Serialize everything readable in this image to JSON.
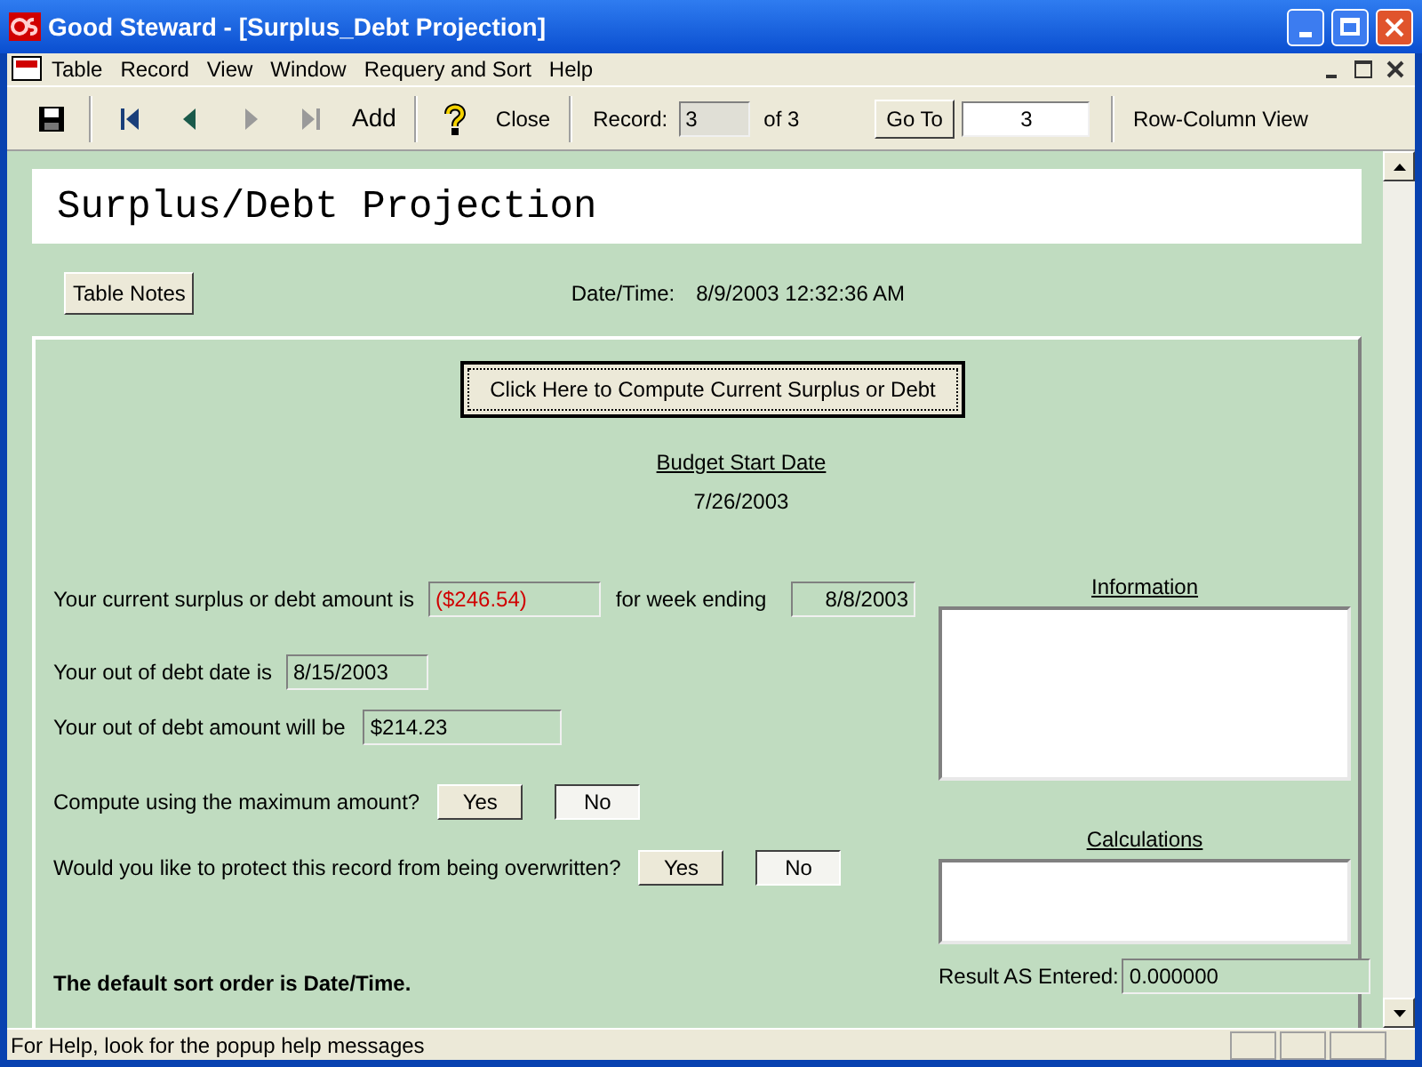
{
  "window": {
    "title": "Good Steward - [Surplus_Debt Projection]"
  },
  "menu": [
    "Table",
    "Record",
    "View",
    "Window",
    "Requery and Sort",
    "Help"
  ],
  "toolbar": [
    {
      "kind": "save",
      "disabled": false
    },
    {
      "kind": "first",
      "disabled": false
    },
    {
      "kind": "prev",
      "disabled": false
    },
    {
      "kind": "next",
      "disabled": true
    },
    {
      "kind": "last",
      "disabled": true
    },
    {
      "kind": "text",
      "label": "Add",
      "disabled": false
    },
    {
      "kind": "help",
      "disabled": false
    },
    {
      "kind": "text",
      "label": "Close",
      "disabled": false
    }
  ],
  "record": {
    "label": "Record:",
    "value": "3",
    "of": "of  3",
    "goto_button": "Go To",
    "goto_value": "3",
    "view_button": "Row-Column View"
  },
  "form": {
    "heading": "Surplus/Debt Projection",
    "table_notes_button": "Table Notes",
    "datetime_label": "Date/Time:",
    "datetime_value": "8/9/2003 12:32:36 AM",
    "compute_button": "Click Here to Compute Current Surplus or Debt",
    "budget_start_label": "Budget Start Date",
    "budget_start_value": "7/26/2003",
    "surplus_label": "Your current surplus or debt amount is",
    "surplus_value": "($246.54)",
    "surplus_negative": true,
    "week_label": "for week ending",
    "week_value": "8/8/2003",
    "debt_date_label": "Your out of debt date is",
    "debt_date_value": "8/15/2003",
    "debt_amount_label": "Your out of debt amount will be",
    "debt_amount_value": "$214.23",
    "questions": [
      {
        "label": "Compute using the maximum amount?",
        "options": [
          {
            "label": "Yes",
            "selected": false
          },
          {
            "label": "No",
            "selected": true
          }
        ]
      },
      {
        "label": "Would you like to protect this record from being overwritten?",
        "options": [
          {
            "label": "Yes",
            "selected": false
          },
          {
            "label": "No",
            "selected": true
          }
        ]
      }
    ],
    "sort_note": "The default sort order is Date/Time.",
    "information_label": "Information",
    "calculations_label": "Calculations",
    "result_label": "Result AS Entered:",
    "result_value": "0.000000"
  },
  "status_bar": "For Help, look for the popup help messages"
}
